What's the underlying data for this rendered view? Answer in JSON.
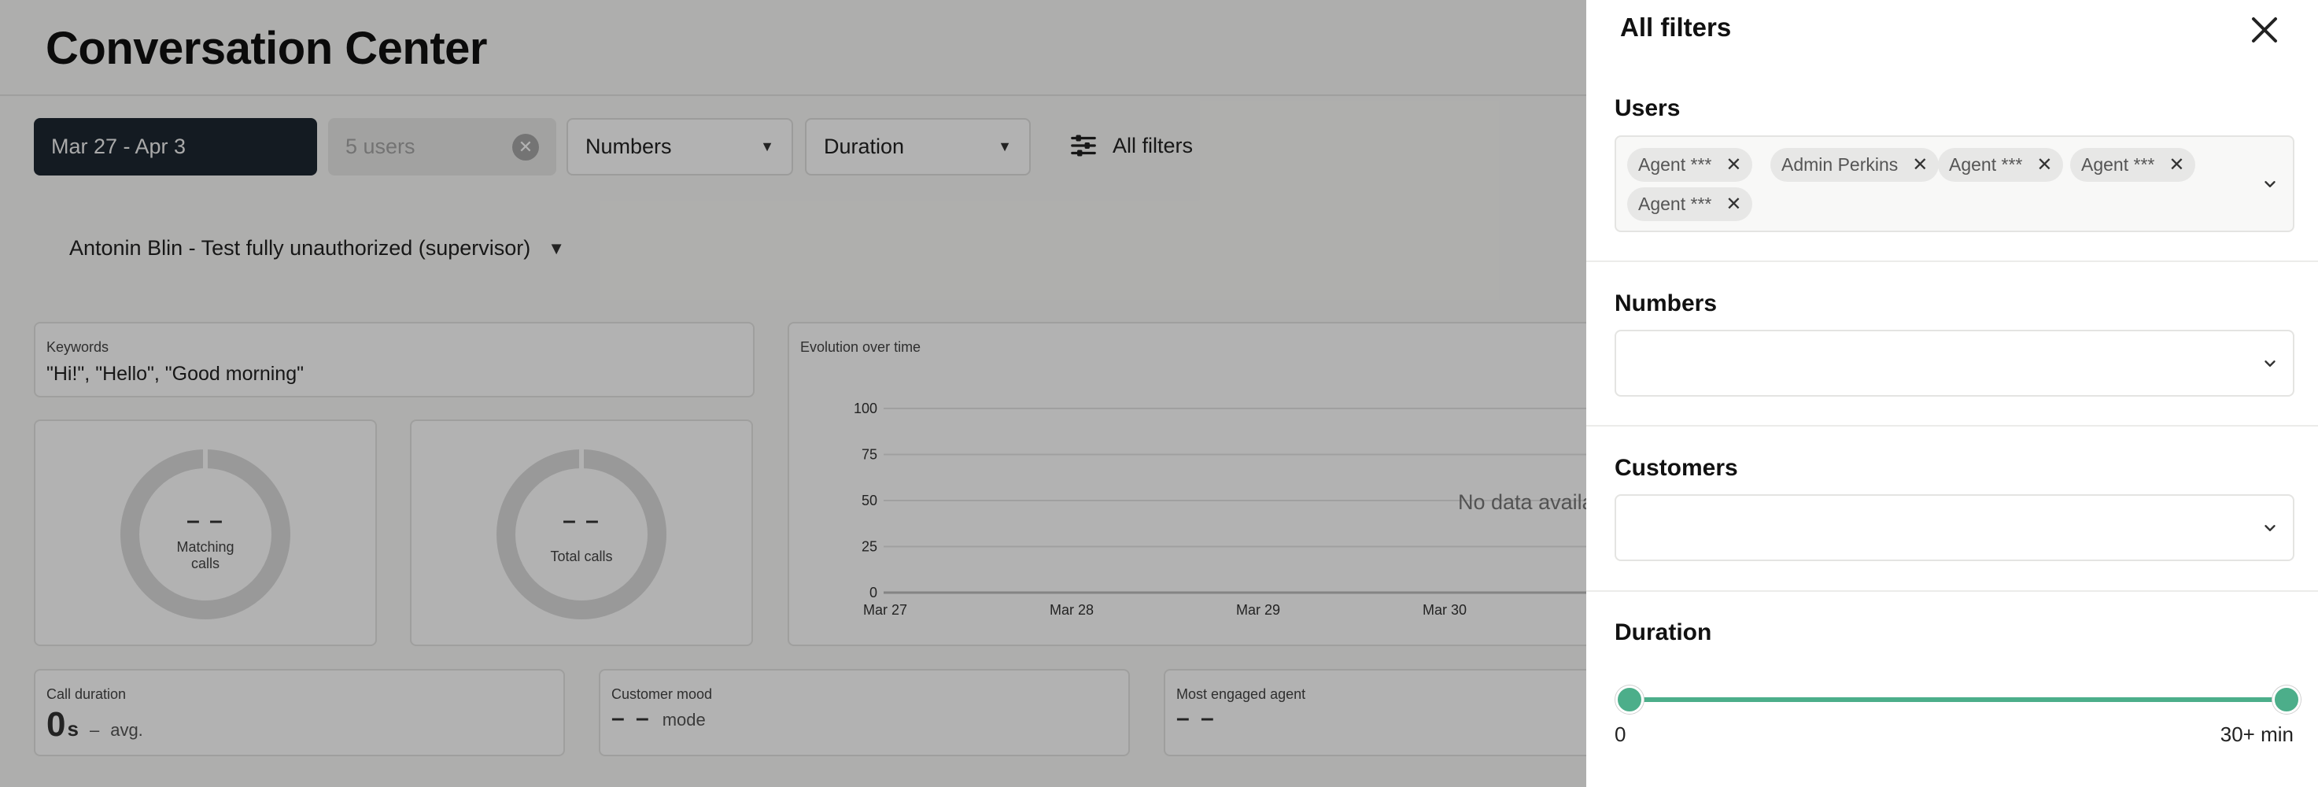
{
  "page": {
    "title": "Conversation Center",
    "filters": {
      "date_range": "Mar 27 - Apr 3",
      "users_placeholder": "5 users",
      "numbers": "Numbers",
      "duration": "Duration",
      "all_filters": "All filters"
    },
    "supervisor": "Antonin Blin - Test fully unauthorized (supervisor)",
    "keywords": {
      "label": "Keywords",
      "value": "\"Hi!\", \"Hello\", \"Good morning\""
    },
    "matching_calls": {
      "value": "– –",
      "label": "Matching calls"
    },
    "total_calls": {
      "value": "– –",
      "label": "Total calls"
    },
    "evolution": {
      "label": "Evolution over time",
      "no_data": "No data availa"
    },
    "call_duration": {
      "label": "Call duration",
      "value": "0",
      "unit": "s",
      "dash": "–",
      "avg": "avg."
    },
    "customer_mood": {
      "label": "Customer mood",
      "value": "– –",
      "suffix": "mode"
    },
    "most_engaged_agent": {
      "label": "Most engaged agent",
      "value": "– –"
    }
  },
  "chart_data": {
    "type": "line",
    "title": "Evolution over time",
    "x": [
      "Mar 27",
      "Mar 28",
      "Mar 29",
      "Mar 30"
    ],
    "series": [],
    "yticks": [
      0,
      25,
      50,
      75,
      100
    ],
    "ylim": [
      0,
      100
    ],
    "grid": true,
    "annotation": "No data availa"
  },
  "panel": {
    "title": "All filters",
    "users": {
      "title": "Users",
      "tags": [
        "Agent ***",
        "Admin Perkins",
        "Agent ***",
        "Agent ***",
        "Agent ***"
      ]
    },
    "numbers": {
      "title": "Numbers",
      "value": ""
    },
    "customers": {
      "title": "Customers",
      "value": ""
    },
    "duration": {
      "title": "Duration",
      "min_label": "0",
      "max_label": "30+ min",
      "selected_min": 0,
      "selected_max_fraction": 1.0
    }
  },
  "colors": {
    "accent": "#4cae8a",
    "date_chip": "#1e2832",
    "overlay": "rgba(0,0,0,0.30)"
  }
}
